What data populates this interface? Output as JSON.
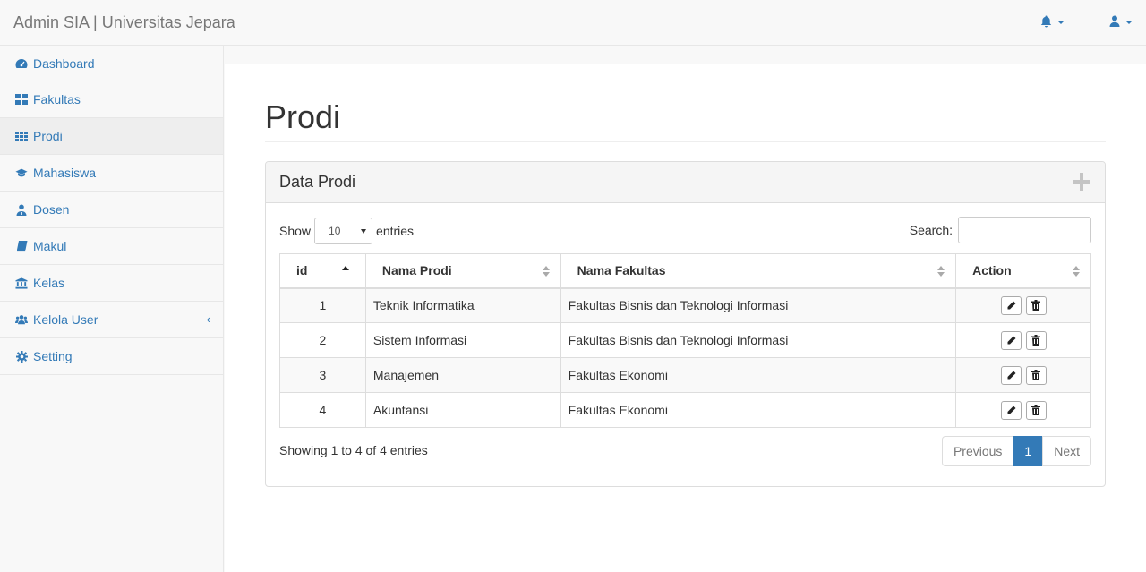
{
  "app": {
    "brand": "Admin SIA | Universitas Jepara"
  },
  "colors": {
    "link": "#337ab7",
    "active_page": "#337ab7",
    "sidebar_bg": "#f8f8f8"
  },
  "navbar": {
    "alerts_icon": "bell-icon",
    "user_icon": "user-icon"
  },
  "sidebar": {
    "items": [
      {
        "label": "Dashboard",
        "icon": "dashboard-icon"
      },
      {
        "label": "Fakultas",
        "icon": "th-large-icon"
      },
      {
        "label": "Prodi",
        "icon": "th-icon",
        "active": true
      },
      {
        "label": "Mahasiswa",
        "icon": "graduation-cap-icon"
      },
      {
        "label": "Dosen",
        "icon": "user-md-icon"
      },
      {
        "label": "Makul",
        "icon": "book-icon"
      },
      {
        "label": "Kelas",
        "icon": "university-icon"
      },
      {
        "label": "Kelola User",
        "icon": "users-icon",
        "arrow": "‹"
      },
      {
        "label": "Setting",
        "icon": "cog-icon"
      }
    ]
  },
  "page": {
    "title": "Prodi"
  },
  "panel": {
    "title": "Data Prodi",
    "show_label": "Show",
    "length_value": "10",
    "entries_label": "entries",
    "search_label": "Search:",
    "search_value": "",
    "columns": [
      "id",
      "Nama Prodi",
      "Nama Fakultas",
      "Action"
    ],
    "rows": [
      {
        "id": "1",
        "prodi": "Teknik Informatika",
        "fakultas": "Fakultas Bisnis dan Teknologi Informasi"
      },
      {
        "id": "2",
        "prodi": "Sistem Informasi",
        "fakultas": "Fakultas Bisnis dan Teknologi Informasi"
      },
      {
        "id": "3",
        "prodi": "Manajemen",
        "fakultas": "Fakultas Ekonomi"
      },
      {
        "id": "4",
        "prodi": "Akuntansi",
        "fakultas": "Fakultas Ekonomi"
      }
    ],
    "info": "Showing 1 to 4 of 4 entries",
    "pagination": {
      "previous": "Previous",
      "current": "1",
      "next": "Next"
    }
  }
}
